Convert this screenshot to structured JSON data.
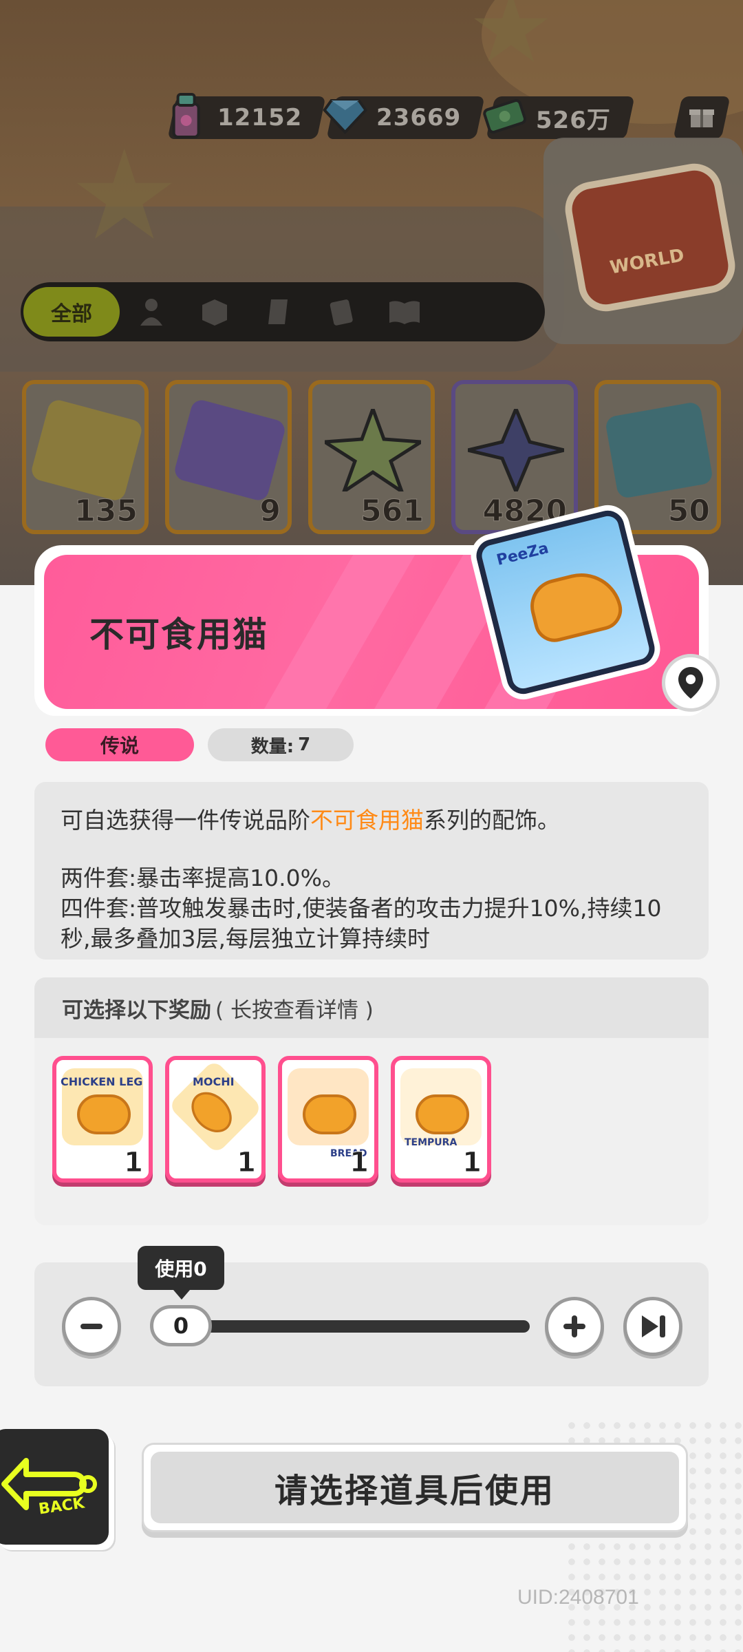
{
  "currencies": [
    {
      "icon": "spray-can-icon",
      "value": "12152"
    },
    {
      "icon": "diamond-icon",
      "value": "23669"
    },
    {
      "icon": "cash-icon",
      "value": "526万"
    }
  ],
  "gift_icon": "gift-icon",
  "tabs": {
    "active_label": "全部",
    "icons": [
      "person-icon",
      "box-icon",
      "tag-icon",
      "card-icon",
      "book-icon"
    ]
  },
  "inventory_counts": [
    "135",
    "9",
    "561",
    "4820",
    "50"
  ],
  "item": {
    "name": "不可食用猫",
    "rarity": "传说",
    "quantity_label": "数量:",
    "quantity": "7",
    "desc_pre": "可自选获得一件传说品阶",
    "desc_highlight": "不可食用猫",
    "desc_post": "系列的配饰。",
    "set2": "两件套:暴击率提高10.0%。",
    "set4": "四件套:普攻触发暴击时,使装备者的攻击力提升10%,持续10秒,最多叠加3层,每层独立计算持续时"
  },
  "pack_brand": "PeeZa",
  "rewards": {
    "title": "可选择以下奖励",
    "hint": "( 长按查看详情 )",
    "items": [
      {
        "name": "CHICKEN LEG",
        "count": "1"
      },
      {
        "name": "MOCHI",
        "count": "1"
      },
      {
        "name": "BREAD",
        "count": "1"
      },
      {
        "name": "TEMPURA",
        "count": "1"
      }
    ]
  },
  "slider": {
    "tooltip": "使用0",
    "value": "0"
  },
  "back_label": "BACK",
  "use_button": "请选择道具后使用",
  "uid": "UID:2408701",
  "colors": {
    "rarity_pink": "#ff5a96",
    "highlight_orange": "#ff8a16"
  }
}
